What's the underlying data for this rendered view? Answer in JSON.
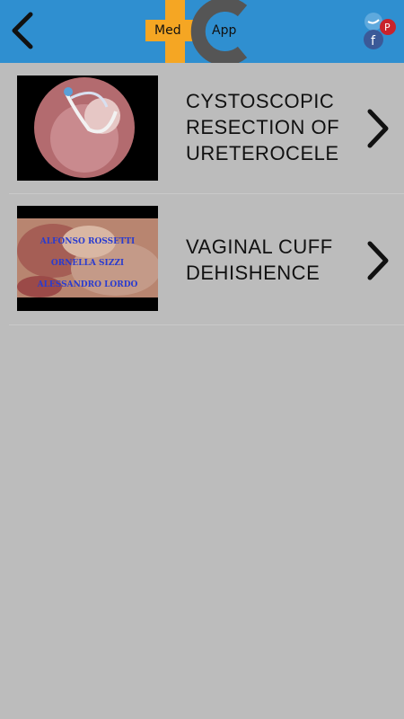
{
  "header": {
    "back_icon": "chevron-left-icon",
    "logo_word_1": "Med",
    "logo_word_2": "App",
    "social_icons": [
      "twitter-icon",
      "facebook-icon",
      "pinterest-icon"
    ],
    "colors": {
      "bar": "#2f8fd0",
      "logo_orange": "#f5a623",
      "logo_gray": "#555555"
    }
  },
  "videos": [
    {
      "title": "CYSTOSCOPIC RESECTION OF URETEROCELE",
      "chevron_icon": "chevron-right-icon"
    },
    {
      "title": "VAGINAL CUFF DEHISHENCE",
      "chevron_icon": "chevron-right-icon",
      "thumbnail_credits": [
        "ALFONSO ROSSETTI",
        "ORNELLA SIZZI",
        "ALESSANDRO LORDO"
      ]
    }
  ],
  "colors": {
    "background": "#bcbcbc",
    "text": "#111111"
  }
}
